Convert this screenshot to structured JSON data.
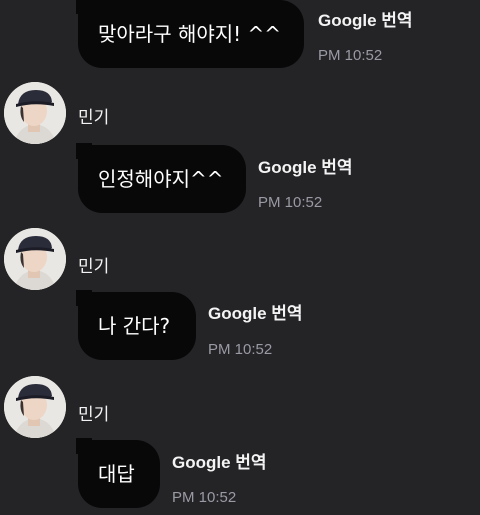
{
  "messages": [
    {
      "text": "맞아라구 해야지! ^^",
      "translator": "Google 번역",
      "time": "PM 10:52"
    },
    {
      "sender": "민기",
      "text": "인정해야지^^",
      "translator": "Google 번역",
      "time": "PM 10:52"
    },
    {
      "sender": "민기",
      "text": "나 간다?",
      "translator": "Google 번역",
      "time": "PM 10:52"
    },
    {
      "sender": "민기",
      "text": "대답",
      "translator": "Google 번역",
      "time": "PM 10:52"
    }
  ]
}
